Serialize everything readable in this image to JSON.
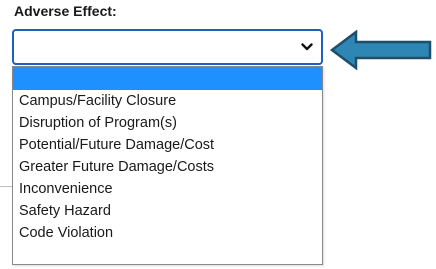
{
  "form": {
    "label": "Adverse Effect:",
    "selected_value": ""
  },
  "dropdown": {
    "options": [
      "",
      "Campus/Facility Closure",
      "Disruption of Program(s)",
      "Potential/Future Damage/Cost",
      "Greater Future Damage/Costs",
      "Inconvenience",
      "Safety Hazard",
      "Code Violation"
    ],
    "highlighted_index": 0
  },
  "annotation": {
    "arrow_icon": "left-arrow-icon",
    "arrow_fill": "#2d86b3",
    "arrow_stroke": "#1f4e6b"
  },
  "colors": {
    "focus_border": "#1f5fbf",
    "highlight": "#1e90ff"
  }
}
